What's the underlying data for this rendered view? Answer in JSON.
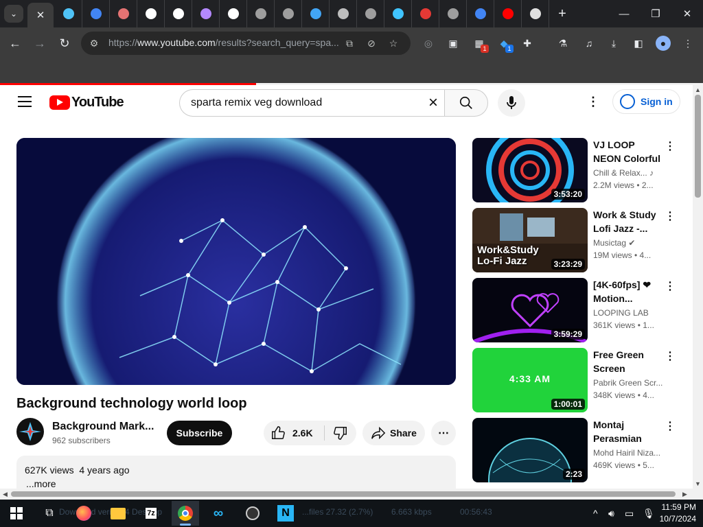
{
  "browser": {
    "tab_menu_icon": "chevron-down-icon",
    "active_tab_close": "✕",
    "favicon_colors": [
      "#4fc3f7",
      "#4285f4",
      "#e57373",
      "#ffffff",
      "#ffffff",
      "#b388ff",
      "#ffffff",
      "#9e9e9e",
      "#9e9e9e",
      "#42a5f5",
      "#bdbdbd",
      "#9e9e9e",
      "#40c4ff",
      "#e53935",
      "#9e9e9e",
      "#4285f4",
      "#ff0000",
      "#e0e0e0"
    ],
    "new_tab": "+",
    "url_prefix": "https://",
    "url_domain": "www.youtube.com",
    "url_rest": "/results?search_query=spa...",
    "extension_badges": [
      "1",
      "1"
    ]
  },
  "youtube": {
    "logo_text": "YouTube",
    "search_query": "sparta remix veg download",
    "sign_in": "Sign in",
    "video": {
      "title": "Background technology world loop",
      "channel": "Background Mark...",
      "subscribers": "962 subscribers",
      "subscribe": "Subscribe",
      "likes": "2.6K",
      "share": "Share",
      "views": "627K views",
      "age": "4 years ago",
      "more": "...more"
    },
    "recommendations": [
      {
        "title": "VJ LOOP NEON Colorful Tunn...",
        "channel": "Chill & Relax...",
        "channel_badge": "♪",
        "meta": "2.2M views  • 2...",
        "duration": "3:53:20",
        "thumb": "neon"
      },
      {
        "title": "Work & Study Lofi Jazz -...",
        "channel": "Musictag",
        "channel_badge": "✔",
        "meta": "19M views  • 4...",
        "duration": "3:23:29",
        "thumb": "lofi",
        "thumb_line1": "Work&Study",
        "thumb_line2": "Lo-Fi Jazz"
      },
      {
        "title": "[4K-60fps] ❤ Motion...",
        "channel": "LOOPING LAB",
        "channel_badge": "",
        "meta": "361K views  • 1...",
        "duration": "3:59:29",
        "thumb": "hearts"
      },
      {
        "title": "Free Green Screen Digital...",
        "channel": "Pabrik Green Scr...",
        "channel_badge": "",
        "meta": "348K views  • 4...",
        "duration": "1:00:01",
        "thumb": "green",
        "thumb_line1": "4:33 AM"
      },
      {
        "title": "Montaj Perasmian",
        "channel": "Mohd Hairil Niza...",
        "channel_badge": "",
        "meta": "469K views  • 5...",
        "duration": "2:23",
        "thumb": "globe"
      }
    ]
  },
  "taskbar": {
    "ghost_text_1": "Download verifier  4 Desktop",
    "ghost_text_2": "...files 27.32 (2.7%)",
    "ghost_text_3": "6.663 kbps",
    "ghost_text_4": "00:56:43",
    "time": "11:59 PM",
    "date": "10/7/2024"
  },
  "progress": {
    "page_load_fraction": 0.364
  }
}
